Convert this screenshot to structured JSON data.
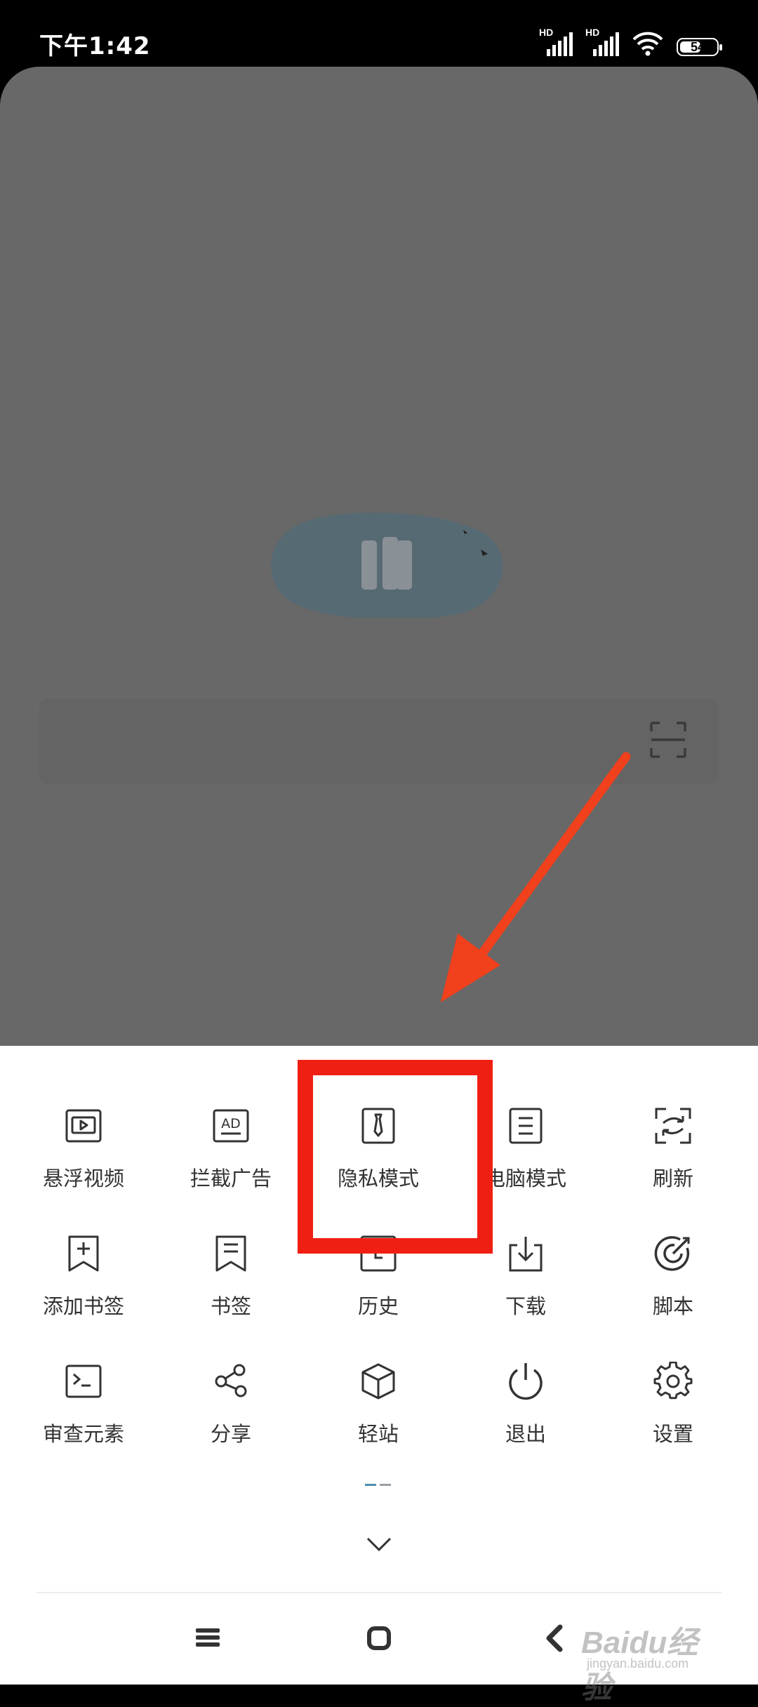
{
  "status_bar": {
    "time": "下午1:42",
    "sim1_tag": "HD",
    "sim2_tag": "HD",
    "battery": "54"
  },
  "menu": {
    "items": [
      {
        "label": "悬浮视频",
        "icon": "floating-video-icon"
      },
      {
        "label": "拦截广告",
        "icon": "ad-block-icon"
      },
      {
        "label": "隐私模式",
        "icon": "privacy-mode-icon"
      },
      {
        "label": "电脑模式",
        "icon": "desktop-mode-icon"
      },
      {
        "label": "刷新",
        "icon": "refresh-icon"
      },
      {
        "label": "添加书签",
        "icon": "add-bookmark-icon"
      },
      {
        "label": "书签",
        "icon": "bookmarks-icon"
      },
      {
        "label": "历史",
        "icon": "history-icon"
      },
      {
        "label": "下载",
        "icon": "download-icon"
      },
      {
        "label": "脚本",
        "icon": "script-icon"
      },
      {
        "label": "审查元素",
        "icon": "inspect-element-icon"
      },
      {
        "label": "分享",
        "icon": "share-icon"
      },
      {
        "label": "轻站",
        "icon": "light-site-icon"
      },
      {
        "label": "退出",
        "icon": "exit-icon"
      },
      {
        "label": "设置",
        "icon": "settings-icon"
      }
    ],
    "active_page": 1,
    "page_count": 2
  },
  "colors": {
    "highlight": "#f01f13",
    "arrow": "#f0401c",
    "page_dim": "#686868",
    "accent": "#4a8fb0"
  },
  "watermark": {
    "brand": "Baidu经验",
    "url": "jingyan.baidu.com"
  }
}
